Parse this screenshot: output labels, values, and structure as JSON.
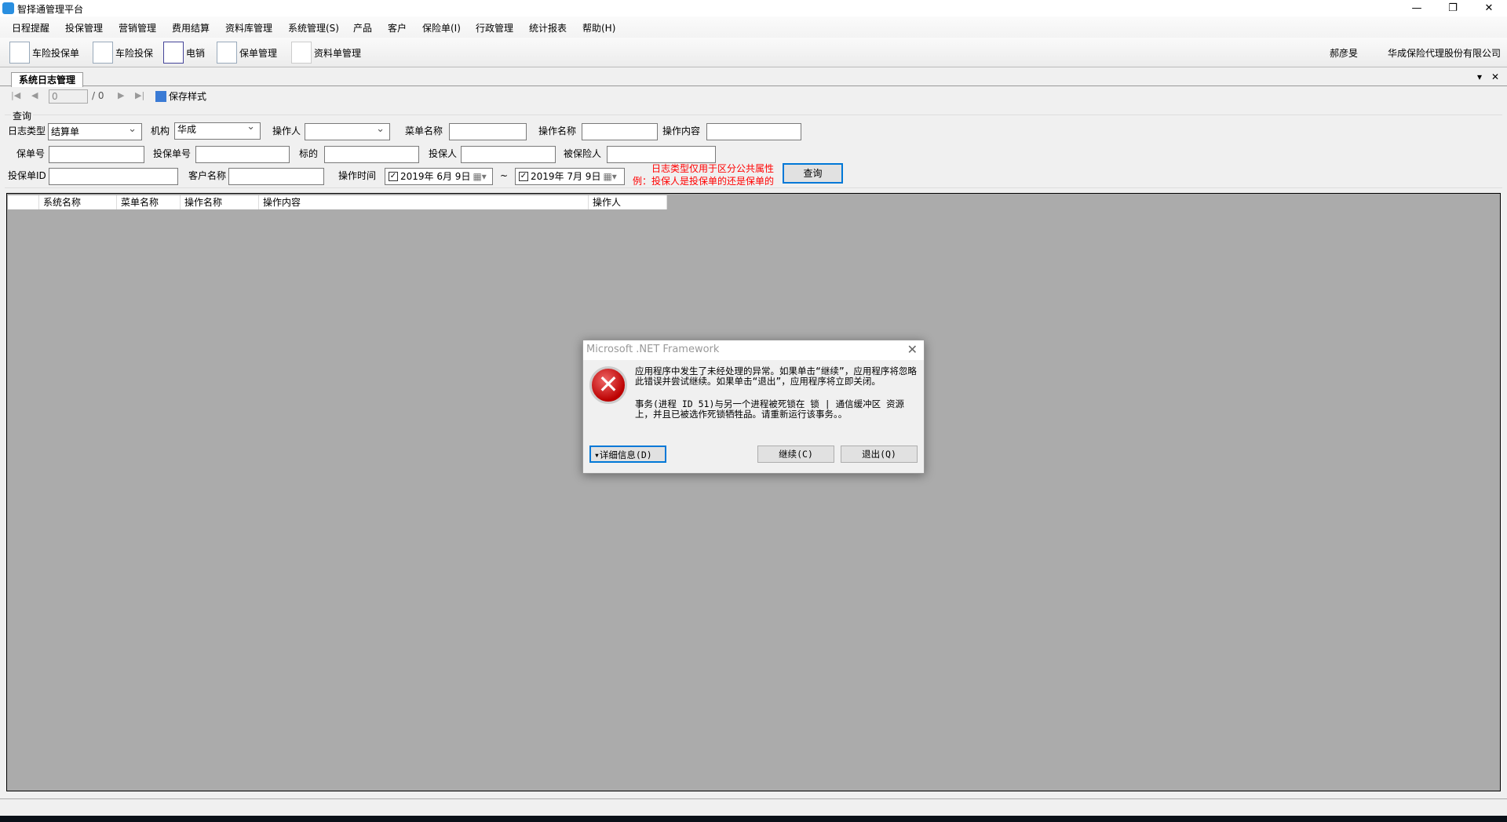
{
  "window": {
    "title": "智择通管理平台",
    "minimize": "—",
    "restore": "❐",
    "close": "✕"
  },
  "menu": [
    "日程提醒",
    "投保管理",
    "营销管理",
    "费用结算",
    "资料库管理",
    "系统管理(S)",
    "产品",
    "客户",
    "保险单(I)",
    "行政管理",
    "统计报表",
    "帮助(H)"
  ],
  "toolbar": {
    "items": [
      "车险投保单",
      "车险投保",
      "电销",
      "保单管理",
      "资料单管理"
    ],
    "user": "郝彦旻",
    "company": "华成保险代理股份有限公司"
  },
  "tab": {
    "label": "系统日志管理",
    "menu": "▾",
    "close": "✕"
  },
  "nav": {
    "first": "|◀",
    "prev": "◀",
    "page": "0",
    "total": "/ 0",
    "next": "▶",
    "last": "▶|",
    "save_style": "保存样式"
  },
  "query": {
    "group": "查询",
    "log_type_label": "日志类型",
    "log_type": "结算单",
    "org_label": "机构",
    "org": "华成",
    "operator_label": "操作人",
    "operator": "",
    "menu_name_label": "菜单名称",
    "op_name_label": "操作名称",
    "op_content_label": "操作内容",
    "policy_no_label": "保单号",
    "app_no_label": "投保单号",
    "subject_label": "标的",
    "applicant_label": "投保人",
    "insured_label": "被保险人",
    "app_id_label": "投保单ID",
    "customer_label": "客户名称",
    "op_time_label": "操作时间",
    "date_from": "2019年  6月  9日",
    "date_to": "2019年  7月  9日",
    "tilde": "~",
    "hint1": "日志类型仅用于区分公共属性",
    "hint2": "例：投保人是投保单的还是保单的",
    "search": "查询"
  },
  "grid": {
    "columns": [
      "系统名称",
      "菜单名称",
      "操作名称",
      "操作内容",
      "操作人"
    ]
  },
  "dialog": {
    "title": "Microsoft .NET Framework",
    "close": "✕",
    "icon": "error-icon",
    "msg1": "应用程序中发生了未经处理的异常。如果单击“继续”，应用程序将忽略此错误并尝试继续。如果单击“退出”，应用程序将立即关闭。",
    "msg2": "事务(进程 ID 51)与另一个进程被死锁在 锁 | 通信缓冲区 资源上，并且已被选作死锁牺牲品。请重新运行该事务。。",
    "details": "▾详细信息(D)",
    "continue": "继续(C)",
    "quit": "退出(Q)"
  }
}
